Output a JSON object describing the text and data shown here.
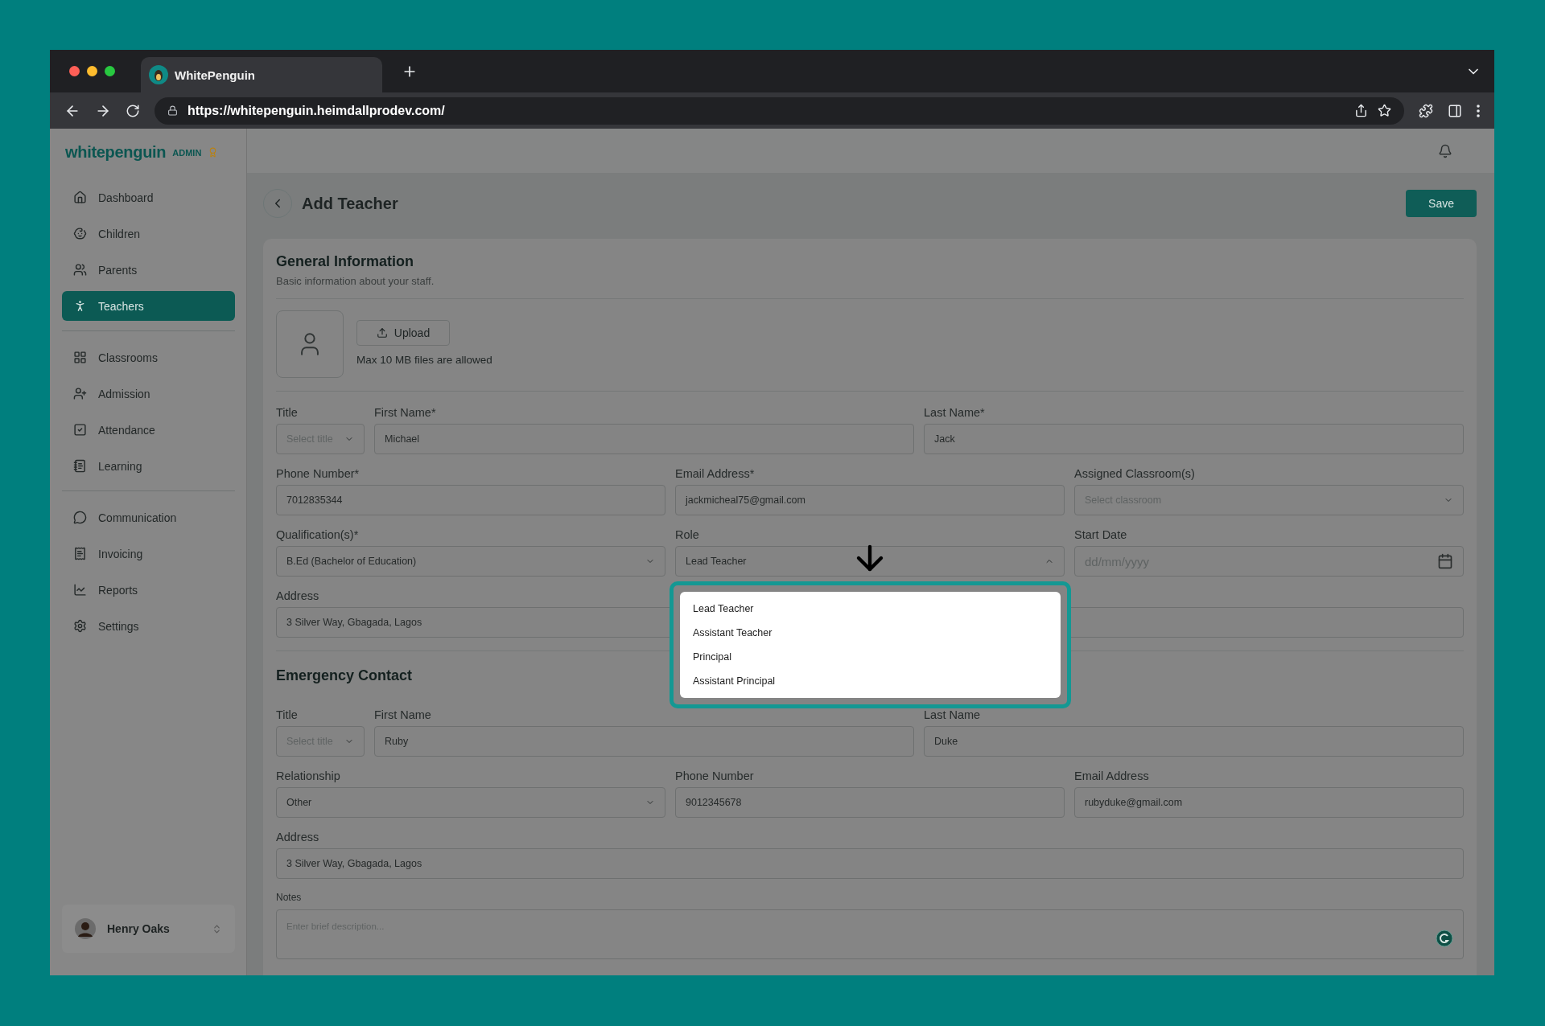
{
  "browser": {
    "tab_title": "WhitePenguin",
    "url": "https://whitepenguin.heimdallprodev.com/"
  },
  "sidebar": {
    "logo": "whitepenguin",
    "badge": "ADMIN",
    "groups": [
      {
        "items": [
          {
            "label": "Dashboard",
            "selected": false
          },
          {
            "label": "Children",
            "selected": false
          },
          {
            "label": "Parents",
            "selected": false
          },
          {
            "label": "Teachers",
            "selected": true
          }
        ]
      },
      {
        "items": [
          {
            "label": "Classrooms",
            "selected": false
          },
          {
            "label": "Admission",
            "selected": false
          },
          {
            "label": "Attendance",
            "selected": false
          },
          {
            "label": "Learning",
            "selected": false
          }
        ]
      },
      {
        "items": [
          {
            "label": "Communication",
            "selected": false
          },
          {
            "label": "Invoicing",
            "selected": false
          },
          {
            "label": "Reports",
            "selected": false
          },
          {
            "label": "Settings",
            "selected": false
          }
        ]
      }
    ],
    "user": {
      "name": "Henry Oaks"
    }
  },
  "page": {
    "title": "Add Teacher",
    "save": "Save"
  },
  "sections": [
    {
      "title": "General Information",
      "subtitle": "Basic information about your staff.",
      "upload": {
        "button": "Upload",
        "hint": "Max 10 MB files are allowed"
      },
      "rows": [
        {
          "kind": "name",
          "fields": [
            {
              "label": "Title",
              "kind": "select",
              "placeholder": "Select title",
              "expanded": false
            },
            {
              "label": "First Name*",
              "kind": "text",
              "value": "Michael"
            },
            {
              "label": "Last Name*",
              "kind": "text",
              "value": "Jack"
            }
          ]
        },
        {
          "kind": "triple",
          "fields": [
            {
              "label": "Phone Number*",
              "kind": "text",
              "value": "7012835344"
            },
            {
              "label": "Email Address*",
              "kind": "text",
              "value": "jackmicheal75@gmail.com"
            },
            {
              "label": "Assigned Classroom(s)",
              "kind": "select",
              "placeholder": "Select classroom",
              "expanded": false
            }
          ]
        },
        {
          "kind": "triple",
          "fields": [
            {
              "label": "Qualification(s)*",
              "kind": "select",
              "value": "B.Ed (Bachelor of Education)",
              "expanded": false
            },
            {
              "label": "Role",
              "kind": "select",
              "value": "Lead Teacher",
              "expanded": true,
              "options": [
                "Lead Teacher",
                "Assistant Teacher",
                "Principal",
                "Assistant Principal"
              ]
            },
            {
              "label": "Start Date",
              "kind": "date",
              "placeholder": "dd/mm/yyyy"
            }
          ]
        },
        {
          "kind": "full",
          "fields": [
            {
              "label": "Address",
              "kind": "text",
              "value": "3 Silver Way, Gbagada, Lagos"
            }
          ]
        }
      ]
    },
    {
      "title": "Emergency Contact",
      "rows": [
        {
          "kind": "name",
          "fields": [
            {
              "label": "Title",
              "kind": "select",
              "placeholder": "Select title",
              "expanded": false
            },
            {
              "label": "First Name",
              "kind": "text",
              "value": "Ruby"
            },
            {
              "label": "Last Name",
              "kind": "text",
              "value": "Duke"
            }
          ]
        },
        {
          "kind": "triple",
          "fields": [
            {
              "label": "Relationship",
              "kind": "select",
              "value": "Other",
              "expanded": false
            },
            {
              "label": "Phone Number",
              "kind": "text",
              "value": "9012345678"
            },
            {
              "label": "Email Address",
              "kind": "text",
              "value": "rubyduke@gmail.com"
            }
          ]
        },
        {
          "kind": "full",
          "fields": [
            {
              "label": "Address",
              "kind": "text",
              "value": "3 Silver Way, Gbagada, Lagos"
            }
          ]
        }
      ],
      "notes": {
        "label": "Notes",
        "placeholder": "Enter brief description..."
      }
    }
  ]
}
